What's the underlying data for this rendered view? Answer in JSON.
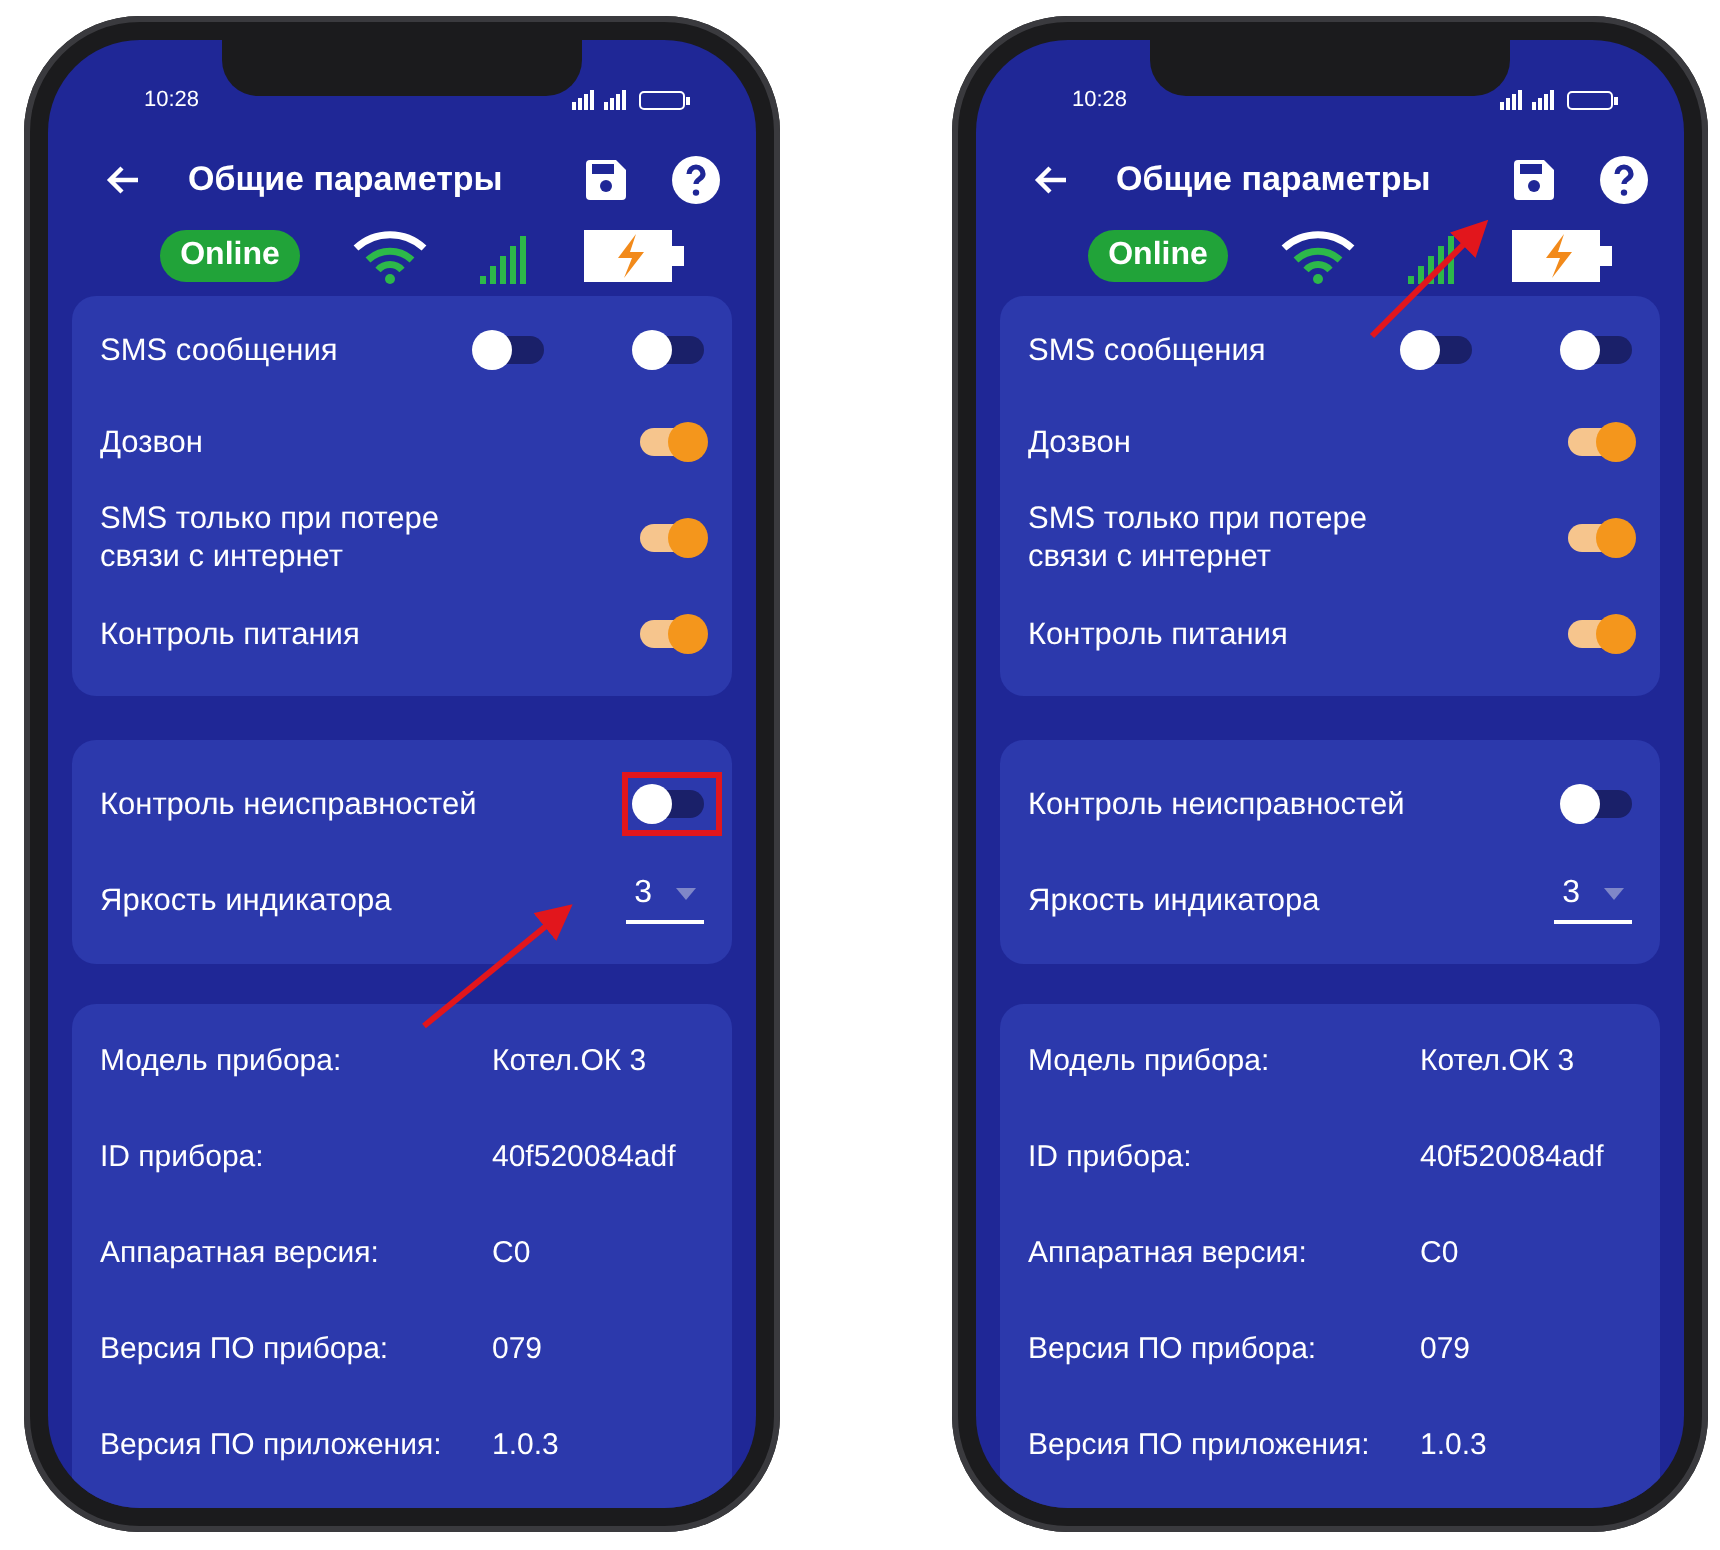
{
  "phones": [
    {
      "time": "10:28",
      "title": "Общие параметры",
      "badge": "Online",
      "arrow": {
        "kind": "toggle"
      },
      "switch_rows": [
        {
          "label": "SMS сообщения",
          "toggles": [
            {
              "on": false
            },
            {
              "on": false
            }
          ],
          "highlighted": false
        },
        {
          "label": "Дозвон",
          "toggles": [
            {
              "on": true
            }
          ],
          "highlighted": false
        },
        {
          "label": "SMS только при потере связи с интернет",
          "toggles": [
            {
              "on": true
            }
          ],
          "highlighted": false
        },
        {
          "label": "Контроль питания",
          "toggles": [
            {
              "on": true
            }
          ],
          "highlighted": false
        }
      ],
      "fault_row": {
        "label": "Контроль неисправностей",
        "toggles": [
          {
            "on": false
          }
        ],
        "highlighted": true
      },
      "brightness": {
        "label": "Яркость индикатора",
        "value": "3"
      },
      "info": [
        {
          "label": "Модель прибора:",
          "value": "Котел.ОК 3"
        },
        {
          "label": "ID прибора:",
          "value": "40f520084adf"
        },
        {
          "label": "Аппаратная версия:",
          "value": "C0"
        },
        {
          "label": "Версия ПО прибора:",
          "value": "079"
        },
        {
          "label": "Версия ПО приложения:",
          "value": "1.0.3"
        }
      ]
    },
    {
      "time": "10:28",
      "title": "Общие параметры",
      "badge": "Online",
      "arrow": {
        "kind": "save"
      },
      "switch_rows": [
        {
          "label": "SMS сообщения",
          "toggles": [
            {
              "on": false
            },
            {
              "on": false
            }
          ],
          "highlighted": false
        },
        {
          "label": "Дозвон",
          "toggles": [
            {
              "on": true
            }
          ],
          "highlighted": false
        },
        {
          "label": "SMS только при потере связи с интернет",
          "toggles": [
            {
              "on": true
            }
          ],
          "highlighted": false
        },
        {
          "label": "Контроль питания",
          "toggles": [
            {
              "on": true
            }
          ],
          "highlighted": false
        }
      ],
      "fault_row": {
        "label": "Контроль неисправностей",
        "toggles": [
          {
            "on": false
          }
        ],
        "highlighted": false
      },
      "brightness": {
        "label": "Яркость индикатора",
        "value": "3"
      },
      "info": [
        {
          "label": "Модель прибора:",
          "value": "Котел.ОК 3"
        },
        {
          "label": "ID прибора:",
          "value": "40f520084adf"
        },
        {
          "label": "Аппаратная версия:",
          "value": "C0"
        },
        {
          "label": "Версия ПО прибора:",
          "value": "079"
        },
        {
          "label": "Версия ПО приложения:",
          "value": "1.0.3"
        }
      ]
    }
  ]
}
